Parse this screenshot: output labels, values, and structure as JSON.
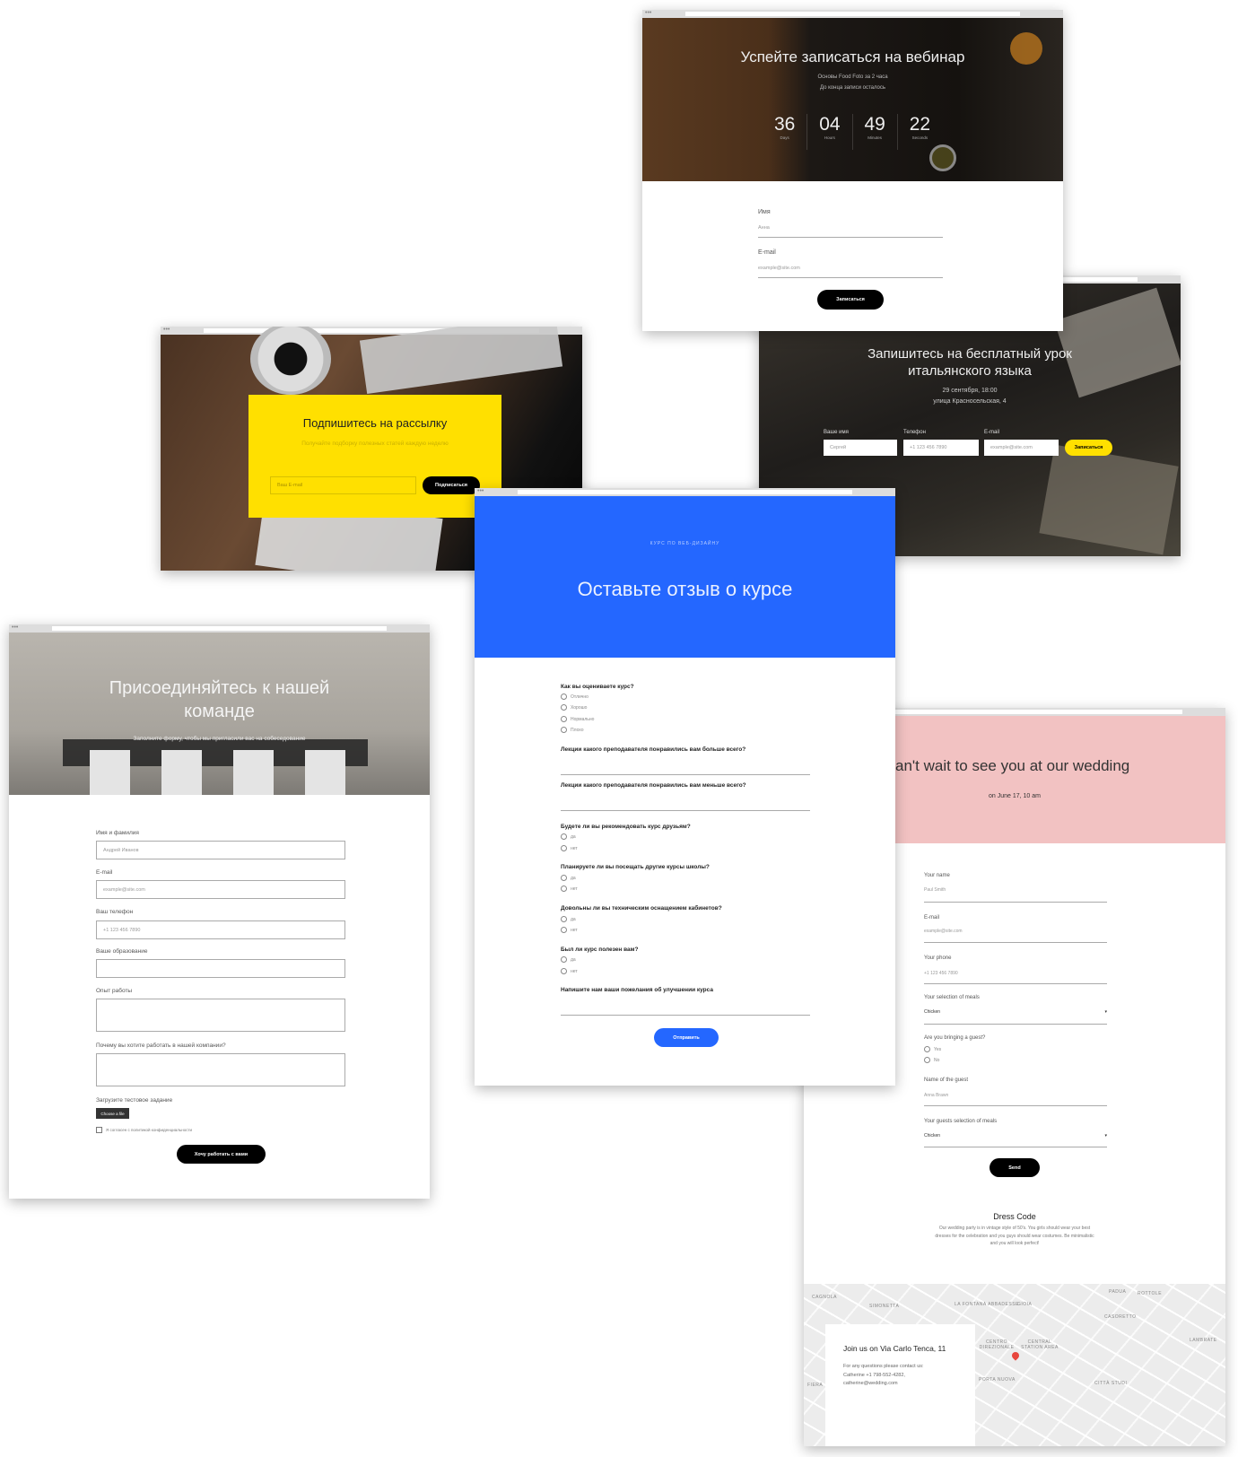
{
  "webinar": {
    "title": "Успейте записаться на вебинар",
    "subtitle1": "Основы Food Foto за 2 часа",
    "subtitle2": "До конца записи осталось",
    "countdown": [
      {
        "value": "36",
        "unit": "Days"
      },
      {
        "value": "04",
        "unit": "Hours"
      },
      {
        "value": "49",
        "unit": "Minutes"
      },
      {
        "value": "22",
        "unit": "Seconds"
      }
    ],
    "name_label": "Имя",
    "name_placeholder": "Анна",
    "email_label": "E-mail",
    "email_placeholder": "example@site.com",
    "submit": "Записаться"
  },
  "italian": {
    "title_line1": "Запишитесь на бесплатный урок",
    "title_line2": "итальянского языка",
    "date": "29 сентября, 18:00",
    "address": "улица Красносельская, 4",
    "fields": [
      {
        "label": "Ваше имя",
        "placeholder": "Сергей"
      },
      {
        "label": "Телефон",
        "placeholder": "+1 123 456 7890"
      },
      {
        "label": "E-mail",
        "placeholder": "example@site.com"
      }
    ],
    "submit": "Записаться",
    "accent": "#ffe000"
  },
  "newsletter": {
    "title": "Подпишитесь на рассылку",
    "subtitle": "Получайте подборку полезных статей каждую неделю",
    "email_placeholder": "Ваш E-mail",
    "submit": "Подписаться",
    "accent": "#ffe000"
  },
  "course": {
    "eyebrow": "КУРС ПО ВЕБ-ДИЗАЙНУ",
    "title": "Оставьте отзыв о курсе",
    "accent": "#2467ff",
    "q1": "Как вы оцениваете курс?",
    "q1_options": [
      "Отлично",
      "Хорошо",
      "Нормально",
      "Плохо"
    ],
    "q2": "Лекции какого преподавателя понравились вам больше всего?",
    "q3": "Лекции какого преподавателя понравились вам меньше всего?",
    "q4": "Будете ли вы рекомендовать курс друзьям?",
    "q5": "Планируете ли вы посещать другие курсы школы?",
    "q6": "Довольны ли вы техническим оснащением кабинетов?",
    "q7": "Был ли курс полезен вам?",
    "yes": "да",
    "no": "нет",
    "q8": "Напишите нам ваши пожелания об улучшении курса",
    "submit": "Отправить"
  },
  "team": {
    "title_line1": "Присоединяйтесь к нашей",
    "title_line2": "команде",
    "subtitle": "Заполните форму, чтобы мы пригласили вас на собеседование",
    "fields": [
      {
        "label": "Имя и фамилия",
        "placeholder": "Андрей Иванов"
      },
      {
        "label": "E-mail",
        "placeholder": "example@site.com"
      },
      {
        "label": "Ваш телефон",
        "placeholder": "+1 123 456 7890"
      },
      {
        "label": "Ваше образование",
        "placeholder": ""
      }
    ],
    "experience_label": "Опыт работы",
    "why_label": "Почему вы хотите работать в нашей компании?",
    "upload_label": "Загрузите тестовое задание",
    "choose_file": "Choose a file",
    "consent": "Я согласен с политикой конфиденциальности",
    "submit": "Хочу работать с вами"
  },
  "wedding": {
    "title": "an't wait to see you at our wedding",
    "date": "on June 17, 10 am",
    "accent": "#f2c2c2",
    "name_label": "Your name",
    "name_placeholder": "Paul Smith",
    "email_label": "E-mail",
    "email_placeholder": "example@site.com",
    "phone_label": "Your phone",
    "phone_placeholder": "+1 123 456 7890",
    "meals_label": "Your selection of meals",
    "meals_value": "Chicken",
    "guest_q": "Are you bringing a guest?",
    "yes": "Yes",
    "no": "No",
    "guest_name_label": "Name of the guest",
    "guest_name_placeholder": "Anna Brawn",
    "guest_meals_label": "Your guests selection of meals",
    "guest_meals_value": "Chicken",
    "submit": "Send",
    "dress_title": "Dress Code",
    "dress_line1": "Our wedding party is in vintage style of 50's. You girls should wear your best",
    "dress_line2": "dresses for the celebration and you guys should wear costumes. Be minimalistic",
    "dress_line3": "and you will look perfect!",
    "map_title": "Join us on Via Carlo Tenca, 11",
    "contact1": "For any questions please contact us:",
    "contact2": "Catherine +1 798-552-4282,",
    "contact3": "catherine@wedding.com",
    "map_labels": [
      "CAGNOLA",
      "SIMONETTA",
      "LA FONTANA ABBADESSE",
      "GIOIA",
      "PADUA",
      "ROTTOLE",
      "CASORETTO",
      "CENTRO DIREZIONALE",
      "CENTRAL STATION AREA",
      "PORTA NUOVA",
      "CITTÀ STUDI",
      "FIERA",
      "LAMBRATE"
    ]
  }
}
